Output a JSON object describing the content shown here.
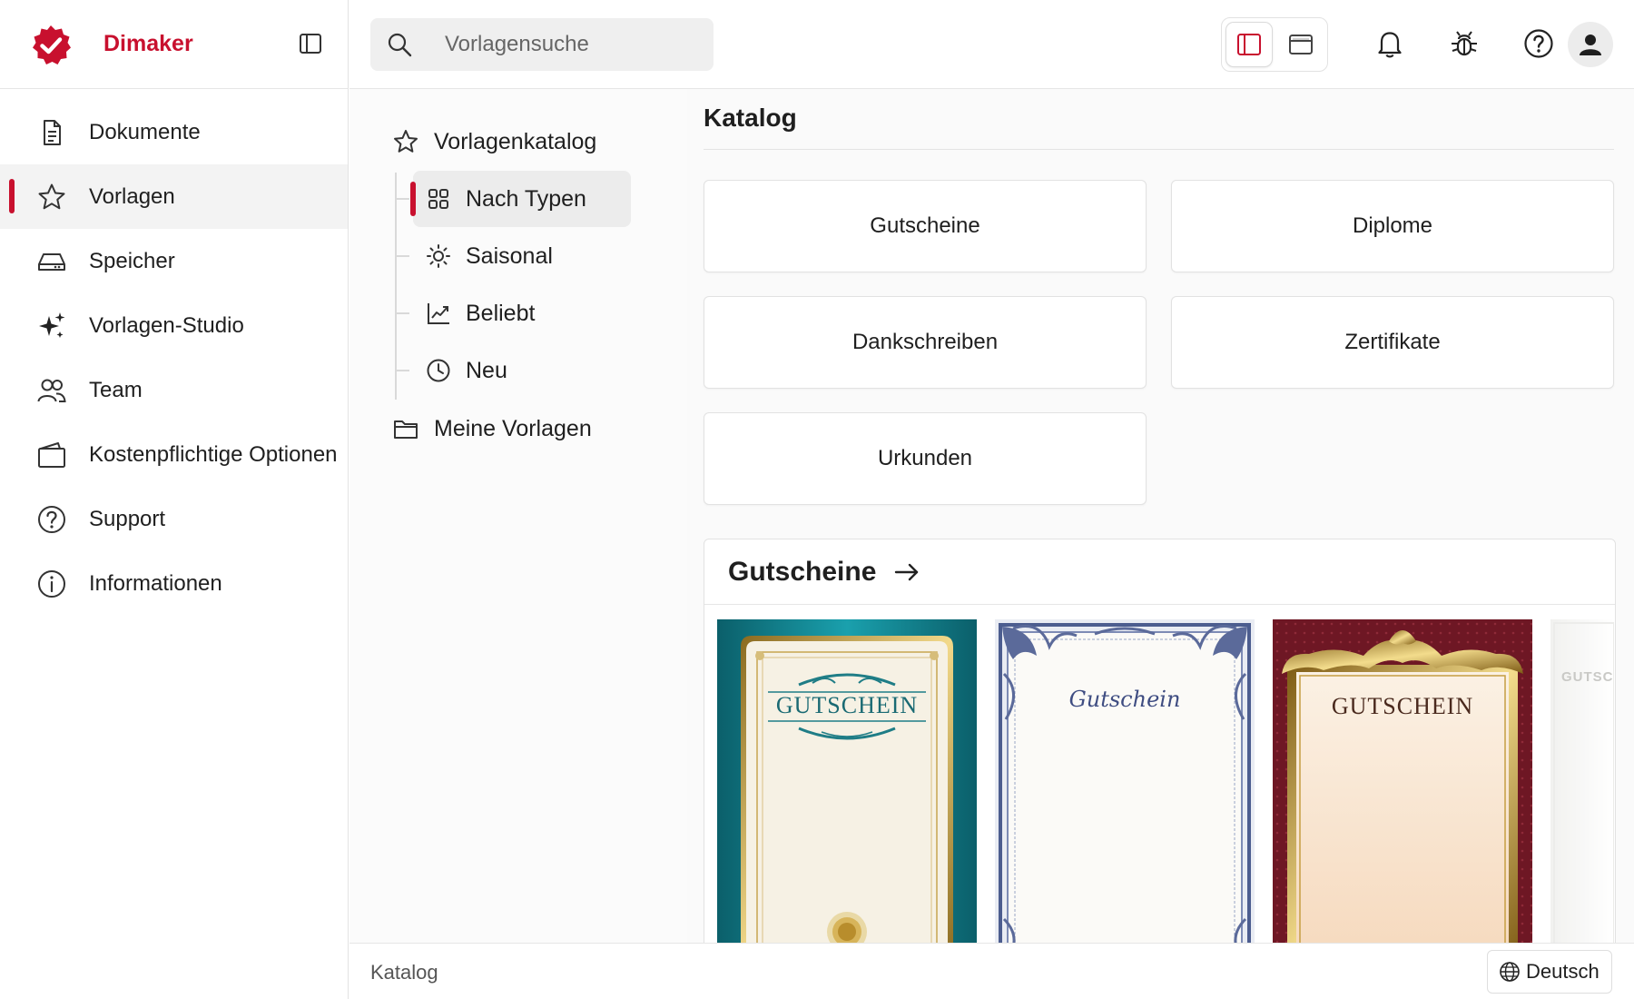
{
  "brand": {
    "name": "Dimaker",
    "accent": "#c8102e"
  },
  "sidebar": {
    "items": [
      {
        "label": "Dokumente",
        "icon": "document-icon"
      },
      {
        "label": "Vorlagen",
        "icon": "star-icon",
        "active": true
      },
      {
        "label": "Speicher",
        "icon": "storage-drive-icon"
      },
      {
        "label": "Vorlagen-Studio",
        "icon": "sparkles-icon"
      },
      {
        "label": "Team",
        "icon": "users-icon"
      },
      {
        "label": "Kostenpflichtige Optionen",
        "icon": "wallet-icon"
      },
      {
        "label": "Support",
        "icon": "help-circle-icon"
      },
      {
        "label": "Informationen",
        "icon": "info-circle-icon"
      }
    ]
  },
  "search": {
    "placeholder": "Vorlagensuche",
    "value": ""
  },
  "tree": {
    "root": {
      "label": "Vorlagenkatalog",
      "icon": "star-icon"
    },
    "children": [
      {
        "label": "Nach Typen",
        "icon": "grid-icon",
        "active": true
      },
      {
        "label": "Saisonal",
        "icon": "sun-icon"
      },
      {
        "label": "Beliebt",
        "icon": "trending-chart-icon"
      },
      {
        "label": "Neu",
        "icon": "clock-icon"
      }
    ],
    "my_templates": {
      "label": "Meine Vorlagen",
      "icon": "folder-icon"
    }
  },
  "main": {
    "title": "Katalog",
    "categories": [
      "Gutscheine",
      "Diplome",
      "Dankschreiben",
      "Zertifikate",
      "Urkunden"
    ],
    "section": {
      "title": "Gutscheine",
      "templates": [
        {
          "caption": "GUTSCHEIN",
          "style": "teal-gold"
        },
        {
          "caption": "Gutschein",
          "style": "navy-ornate"
        },
        {
          "caption": "GUTSCHEIN",
          "style": "burgundy-gold"
        },
        {
          "caption": "GUTSC",
          "style": "faded"
        }
      ]
    }
  },
  "footer": {
    "breadcrumb": "Katalog",
    "language": "Deutsch"
  }
}
